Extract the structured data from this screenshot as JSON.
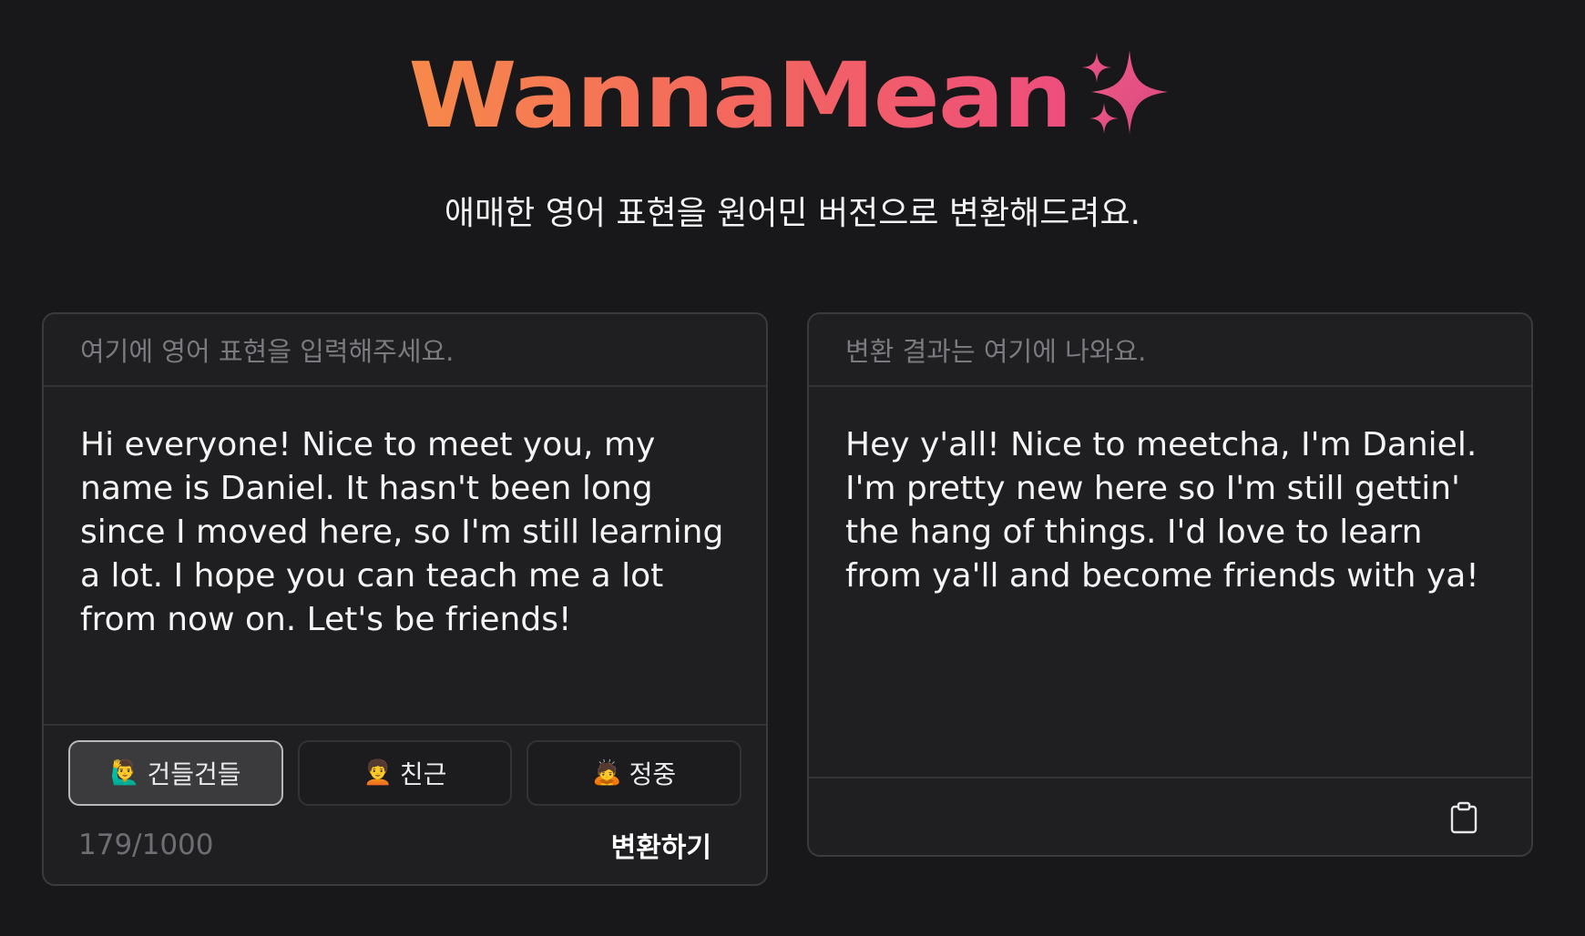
{
  "header": {
    "logo_text": "WannaMean",
    "sparkle_icon": "sparkles-icon",
    "subtitle": "애매한 영어 표현을 원어민 버전으로 변환해드려요."
  },
  "input_panel": {
    "placeholder": "여기에 영어 표현을 입력해주세요.",
    "text": "Hi everyone! Nice to meet you, my name is Daniel. It hasn't been long since I moved here, so I'm still learning a lot. I hope you can teach me a lot from now on. Let's be friends!",
    "tones": [
      {
        "emoji": "🙋‍♂️",
        "label": "건들건들",
        "selected": true
      },
      {
        "emoji": "🧑‍🦱",
        "label": "친근",
        "selected": false
      },
      {
        "emoji": "🙇",
        "label": "정중",
        "selected": false
      }
    ],
    "char_count": "179/1000",
    "convert_label": "변환하기"
  },
  "output_panel": {
    "placeholder": "변환 결과는 여기에 나와요.",
    "text": "Hey y'all! Nice to meetcha, I'm Daniel. I'm pretty new here so I'm still gettin' the hang of things. I'd love to learn from ya'll and become friends with ya!",
    "copy_icon": "clipboard-icon"
  },
  "colors": {
    "background": "#18181a",
    "panel": "#1f1f21",
    "gradient_start": "#f7894a",
    "gradient_end": "#ee4d7d",
    "sparkle": "#e9568a"
  }
}
